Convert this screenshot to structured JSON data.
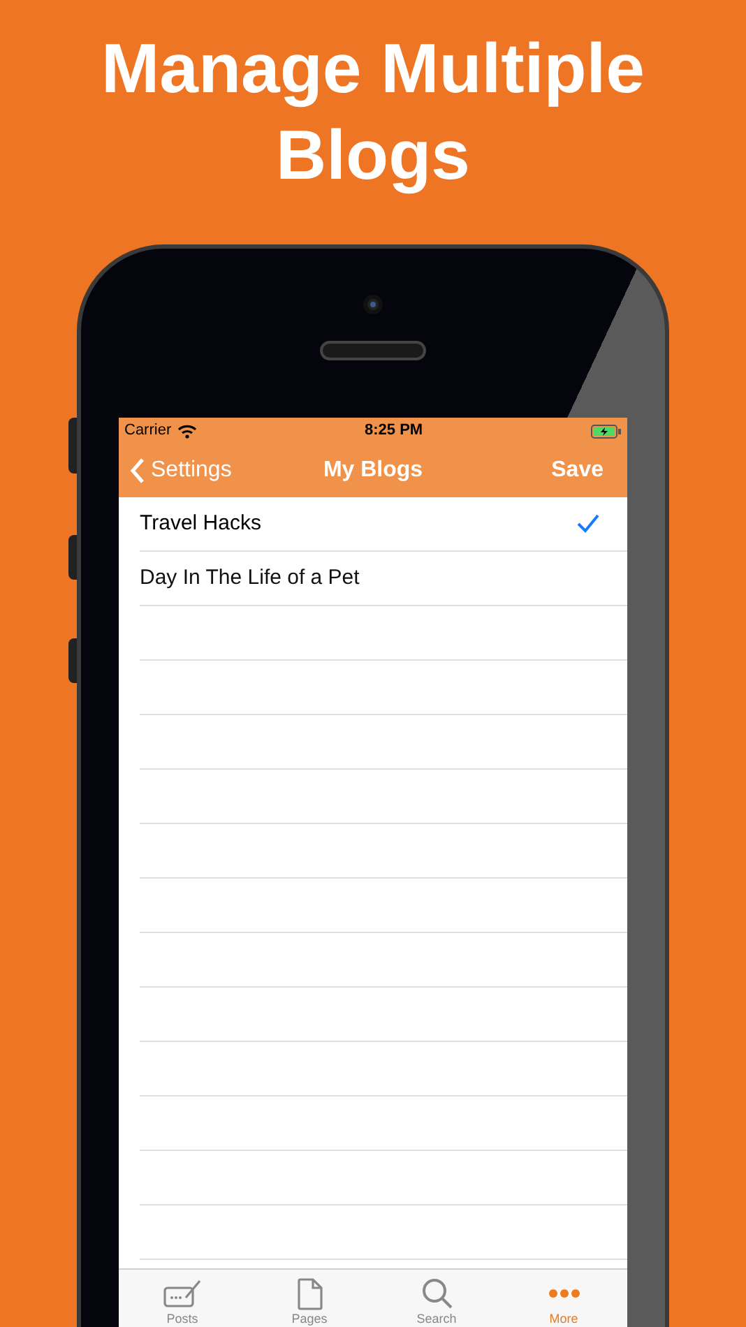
{
  "headline": "Manage Multiple Blogs",
  "status_bar": {
    "carrier": "Carrier",
    "time": "8:25 PM"
  },
  "nav": {
    "back": "Settings",
    "title": "My Blogs",
    "action": "Save"
  },
  "blogs": [
    {
      "name": "Travel Hacks",
      "selected": true
    },
    {
      "name": "Day In The Life of a Pet",
      "selected": false
    }
  ],
  "tabs": [
    {
      "kind": "posts",
      "label": "Posts",
      "selected": false
    },
    {
      "kind": "pages",
      "label": "Pages",
      "selected": false
    },
    {
      "kind": "search",
      "label": "Search",
      "selected": false
    },
    {
      "kind": "more",
      "label": "More",
      "selected": true
    }
  ]
}
